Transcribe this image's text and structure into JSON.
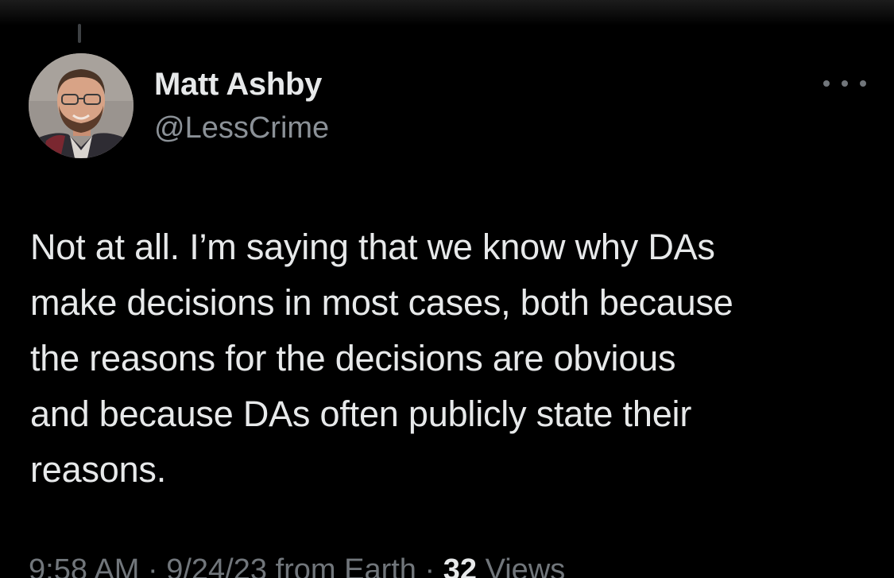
{
  "author": {
    "name": "Matt Ashby",
    "handle": "@LessCrime"
  },
  "tweet": {
    "text": "Not at all. I’m saying that we know why DAs\nmake decisions in most cases, both because\nthe reasons for the decisions are obvious\nand because DAs often publicly state their\nreasons."
  },
  "meta": {
    "time": "9:58 AM",
    "separator": "·",
    "date": "9/24/23",
    "source": "from Earth",
    "views_count": "32",
    "views_label": "Views"
  },
  "icons": {
    "more": "more-horizontal-icon"
  },
  "colors": {
    "background": "#000000",
    "primary_text": "#e7e9ea",
    "secondary_text": "#71767b"
  }
}
